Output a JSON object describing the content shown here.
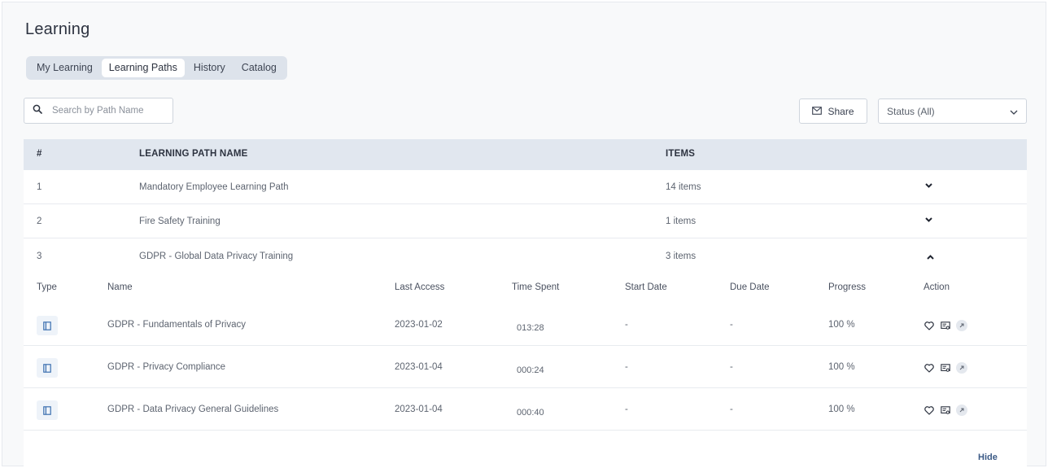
{
  "page": {
    "title": "Learning"
  },
  "tabs": [
    {
      "label": "My Learning",
      "active": false
    },
    {
      "label": "Learning Paths",
      "active": true
    },
    {
      "label": "History",
      "active": false
    },
    {
      "label": "Catalog",
      "active": false
    }
  ],
  "search": {
    "placeholder": "Search by Path Name",
    "value": "",
    "icon": "search-icon"
  },
  "share": {
    "label": "Share",
    "icon": "mail-icon"
  },
  "status_filter": {
    "selected": "Status (All)",
    "icon": "chevron-down-icon"
  },
  "table": {
    "columns": {
      "index": "#",
      "name": "LEARNING PATH NAME",
      "items": "ITEMS"
    },
    "rows": [
      {
        "index": "1",
        "name": "Mandatory Employee Learning Path",
        "items": "14 items",
        "expanded": false
      },
      {
        "index": "2",
        "name": "Fire Safety Training",
        "items": "1 items",
        "expanded": false
      },
      {
        "index": "3",
        "name": "GDPR - Global Data Privacy Training",
        "items": "3 items",
        "expanded": true
      }
    ]
  },
  "detail": {
    "columns": {
      "type": "Type",
      "name": "Name",
      "last_access": "Last Access",
      "time_spent": "Time Spent",
      "start_date": "Start Date",
      "due_date": "Due Date",
      "progress": "Progress",
      "action": "Action"
    },
    "rows": [
      {
        "name": "GDPR - Fundamentals of Privacy",
        "last_access": "2023-01-02",
        "time_spent": "013:28",
        "start_date": "-",
        "due_date": "-",
        "progress": "100 %"
      },
      {
        "name": "GDPR - Privacy Compliance",
        "last_access": "2023-01-04",
        "time_spent": "000:24",
        "start_date": "-",
        "due_date": "-",
        "progress": "100 %"
      },
      {
        "name": "GDPR - Data Privacy General Guidelines",
        "last_access": "2023-01-04",
        "time_spent": "000:40",
        "start_date": "-",
        "due_date": "-",
        "progress": "100 %"
      }
    ],
    "hide_label": "Hide"
  },
  "colors": {
    "accent": "#3b5a86",
    "header_bg": "#e1e7ef",
    "tabs_bg": "#dde3eb",
    "type_icon": "#3b6fb0"
  }
}
